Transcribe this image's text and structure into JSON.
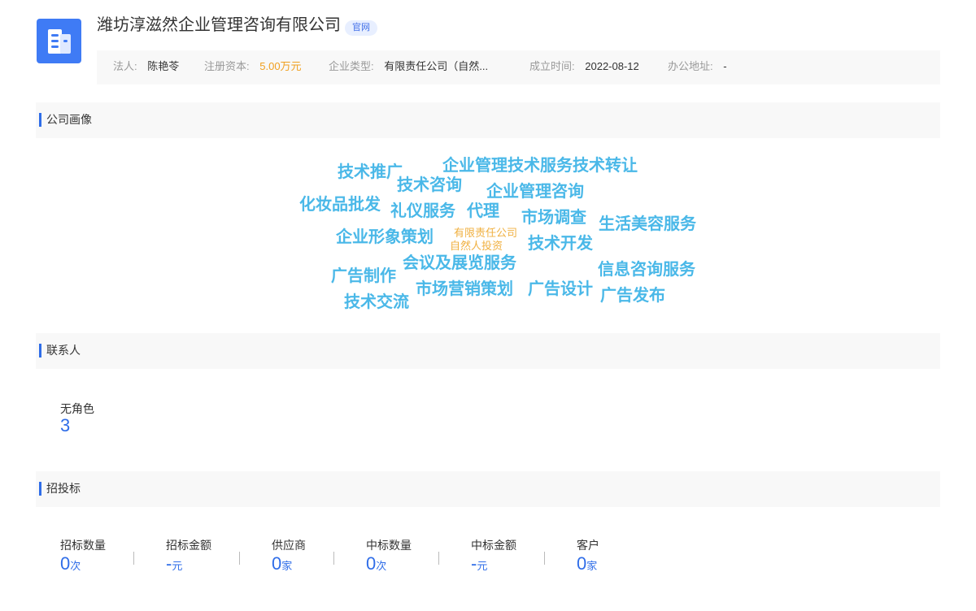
{
  "company": {
    "name": "潍坊淳滋然企业管理咨询有限公司",
    "official_site_tag": "官网",
    "logo_icon": "building-icon",
    "brand_color": "#3f7bf5"
  },
  "info": {
    "legal_rep_label": "法人:",
    "legal_rep_value": "陈艳苓",
    "capital_label": "注册资本:",
    "capital_value": "5.00万元",
    "type_label": "企业类型:",
    "type_value": "有限责任公司（自然...",
    "founded_label": "成立时间:",
    "founded_value": "2022-08-12",
    "address_label": "办公地址:",
    "address_value": "-"
  },
  "sections": {
    "portrait": "公司画像",
    "contacts": "联系人",
    "bidding": "招投标"
  },
  "word_cloud": {
    "words": [
      "技术推广",
      "企业管理技术服务技术转让",
      "技术咨询",
      "企业管理咨询",
      "化妆品批发",
      "礼仪服务",
      "代理",
      "市场调查",
      "生活美容服务",
      "企业形象策划",
      "有限责任公司",
      "自然人投资",
      "技术开发",
      "会议及展览服务",
      "信息咨询服务",
      "广告制作",
      "市场营销策划",
      "广告设计",
      "广告发布",
      "技术交流"
    ]
  },
  "contacts": {
    "role_label": "无角色",
    "role_count": "3"
  },
  "bidding": {
    "stats": [
      {
        "label": "招标数量",
        "value": "0",
        "unit": "次"
      },
      {
        "label": "招标金额",
        "value": "-",
        "unit": "元"
      },
      {
        "label": "供应商",
        "value": "0",
        "unit": "家"
      },
      {
        "label": "中标数量",
        "value": "0",
        "unit": "次"
      },
      {
        "label": "中标金额",
        "value": "-",
        "unit": "元"
      },
      {
        "label": "客户",
        "value": "0",
        "unit": "家"
      }
    ]
  },
  "colors": {
    "accent": "#2f6de8",
    "cloud_word": "#4ab8e8",
    "cloud_small": "#f0b040",
    "capital": "#f0a020"
  }
}
